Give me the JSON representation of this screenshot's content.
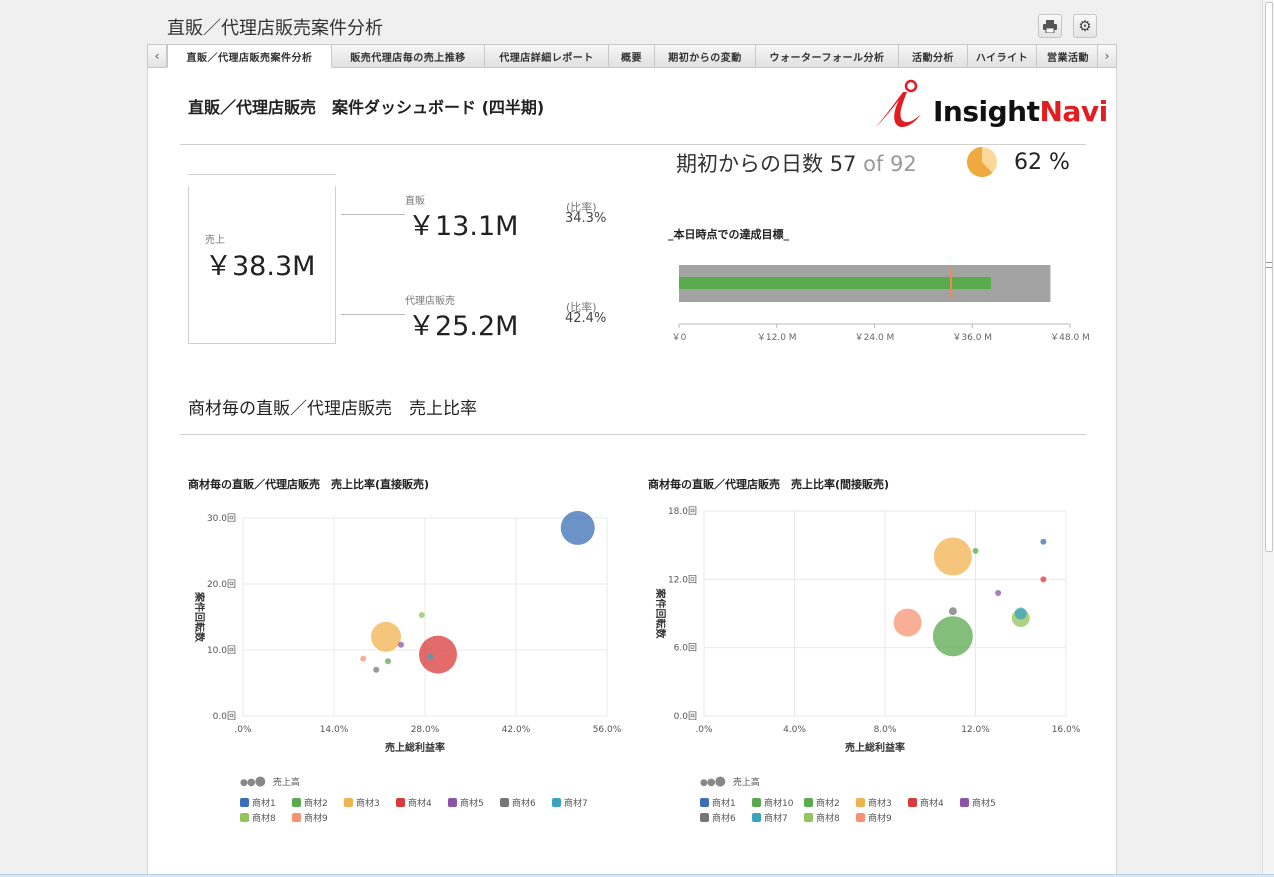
{
  "app": {
    "title": "直販／代理店販売案件分析"
  },
  "tabs": {
    "items": [
      {
        "label": "直販／代理店販売案件分析",
        "active": true
      },
      {
        "label": "販売代理店毎の売上推移"
      },
      {
        "label": "代理店詳細レポート"
      },
      {
        "label": "概要"
      },
      {
        "label": "期初からの変動"
      },
      {
        "label": "ウォーターフォール分析"
      },
      {
        "label": "活動分析"
      },
      {
        "label": "ハイライト"
      },
      {
        "label": "営業活動"
      }
    ]
  },
  "dashboard": {
    "title": "直販／代理店販売　案件ダッシュボード (四半期)",
    "logo": {
      "brand_a": "Insight",
      "brand_b": "Navi"
    },
    "days": {
      "label": "期初からの日数",
      "current": "57",
      "of_label": "of",
      "total": "92",
      "percent": "62 %",
      "fraction": 0.62
    },
    "sales": {
      "label": "売上",
      "value": "￥38.3M"
    },
    "direct": {
      "label": "直販",
      "value": "￥13.1M",
      "ratio_label": "(比率)",
      "ratio": "34.3%"
    },
    "agency": {
      "label": "代理店販売",
      "value": "￥25.2M",
      "ratio_label": "(比率)",
      "ratio": "42.4%"
    },
    "bullet": {
      "title": "_本日時点での達成目標_",
      "ticks": [
        "￥0",
        "￥12.0 M",
        "￥24.0 M",
        "￥36.0 M",
        "￥48.0 M"
      ],
      "max": 48,
      "range": 45.6,
      "actual": 38.3,
      "target": 33.4
    }
  },
  "section2": {
    "title": "商材毎の直販／代理店販売　売上比率"
  },
  "colors": {
    "p1": "#3a6fb5",
    "p2": "#5aab4d",
    "p3": "#f0b24e",
    "p4": "#d93a3a",
    "p5": "#8b53a6",
    "p6": "#777777",
    "p7": "#3aa3c0",
    "p8": "#93c35b",
    "p9": "#f59473",
    "p10": "#5aa84d"
  },
  "chart_data": [
    {
      "type": "scatter",
      "title": "商材毎の直販／代理店販売　売上比率(直接販売)",
      "xlabel": "売上総利益率",
      "ylabel": "案件回転数",
      "xlim": [
        0,
        56
      ],
      "ylim": [
        0,
        30
      ],
      "xticks": [
        ".0%",
        "14.0%",
        "28.0%",
        "42.0%",
        "56.0%"
      ],
      "yticks": [
        "0.0回",
        "10.0回",
        "20.0回",
        "30.0回"
      ],
      "size_legend": "売上高",
      "legend": [
        "商材1",
        "商材2",
        "商材3",
        "商材4",
        "商材5",
        "商材6",
        "商材7",
        "商材8",
        "商材9"
      ],
      "series": [
        {
          "name": "商材1",
          "x": 51.5,
          "y": 28.5,
          "r": 17
        },
        {
          "name": "商材2",
          "x": 22.3,
          "y": 8.3,
          "r": 3
        },
        {
          "name": "商材3",
          "x": 22.0,
          "y": 12.0,
          "r": 15
        },
        {
          "name": "商材4",
          "x": 30.0,
          "y": 9.3,
          "r": 19
        },
        {
          "name": "商材5",
          "x": 24.3,
          "y": 10.8,
          "r": 3
        },
        {
          "name": "商材6",
          "x": 20.5,
          "y": 7.0,
          "r": 3
        },
        {
          "name": "商材7",
          "x": 28.8,
          "y": 9.0,
          "r": 3
        },
        {
          "name": "商材8",
          "x": 27.5,
          "y": 15.3,
          "r": 3
        },
        {
          "name": "商材9",
          "x": 18.5,
          "y": 8.7,
          "r": 3
        }
      ]
    },
    {
      "type": "scatter",
      "title": "商材毎の直販／代理店販売　売上比率(間接販売)",
      "xlabel": "売上総利益率",
      "ylabel": "案件回転数",
      "xlim": [
        0,
        16
      ],
      "ylim": [
        0,
        18
      ],
      "xticks": [
        ".0%",
        "4.0%",
        "8.0%",
        "12.0%",
        "16.0%"
      ],
      "yticks": [
        "0.0回",
        "6.0回",
        "12.0回",
        "18.0回"
      ],
      "size_legend": "売上高",
      "legend": [
        "商材1",
        "商材10",
        "商材2",
        "商材3",
        "商材4",
        "商材5",
        "商材6",
        "商材7",
        "商材8",
        "商材9"
      ],
      "series": [
        {
          "name": "商材1",
          "x": 15.0,
          "y": 15.3,
          "r": 3
        },
        {
          "name": "商材10",
          "x": 11.0,
          "y": 7.0,
          "r": 20
        },
        {
          "name": "商材2",
          "x": 12.0,
          "y": 14.5,
          "r": 3
        },
        {
          "name": "商材3",
          "x": 11.0,
          "y": 14.0,
          "r": 19
        },
        {
          "name": "商材4",
          "x": 15.0,
          "y": 12.0,
          "r": 3
        },
        {
          "name": "商材5",
          "x": 13.0,
          "y": 10.8,
          "r": 3
        },
        {
          "name": "商材6",
          "x": 11.0,
          "y": 9.2,
          "r": 4
        },
        {
          "name": "商材7",
          "x": 14.0,
          "y": 9.0,
          "r": 6
        },
        {
          "name": "商材8",
          "x": 14.0,
          "y": 8.6,
          "r": 9
        },
        {
          "name": "商材9",
          "x": 9.0,
          "y": 8.2,
          "r": 14
        }
      ]
    }
  ]
}
